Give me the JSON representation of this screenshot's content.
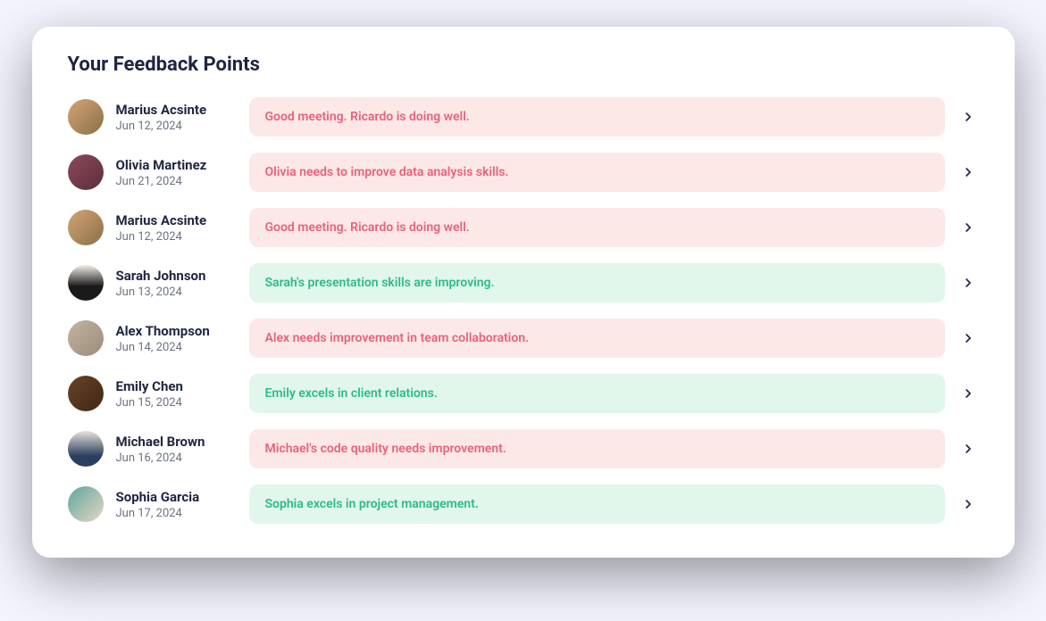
{
  "title": "Your Feedback Points",
  "items": [
    {
      "name": "Marius Acsinte",
      "date": "Jun 12, 2024",
      "text": "Good meeting. Ricardo is doing well.",
      "sentiment": "negative",
      "avatar": "av-1"
    },
    {
      "name": "Olivia Martinez",
      "date": "Jun 21, 2024",
      "text": "Olivia needs to improve data analysis skills.",
      "sentiment": "negative",
      "avatar": "av-2"
    },
    {
      "name": "Marius Acsinte",
      "date": "Jun 12, 2024",
      "text": "Good meeting. Ricardo is doing well.",
      "sentiment": "negative",
      "avatar": "av-3"
    },
    {
      "name": "Sarah Johnson",
      "date": "Jun 13, 2024",
      "text": "Sarah's presentation skills are improving.",
      "sentiment": "positive",
      "avatar": "av-4"
    },
    {
      "name": "Alex Thompson",
      "date": "Jun 14, 2024",
      "text": "Alex needs improvement in team collaboration.",
      "sentiment": "negative",
      "avatar": "av-5"
    },
    {
      "name": "Emily Chen",
      "date": "Jun 15, 2024",
      "text": "Emily excels in client relations.",
      "sentiment": "positive",
      "avatar": "av-6"
    },
    {
      "name": "Michael Brown",
      "date": "Jun 16, 2024",
      "text": "Michael's code quality needs improvement.",
      "sentiment": "negative",
      "avatar": "av-7"
    },
    {
      "name": "Sophia Garcia",
      "date": "Jun 17, 2024",
      "text": "Sophia excels in project management.",
      "sentiment": "positive",
      "avatar": "av-8"
    }
  ]
}
